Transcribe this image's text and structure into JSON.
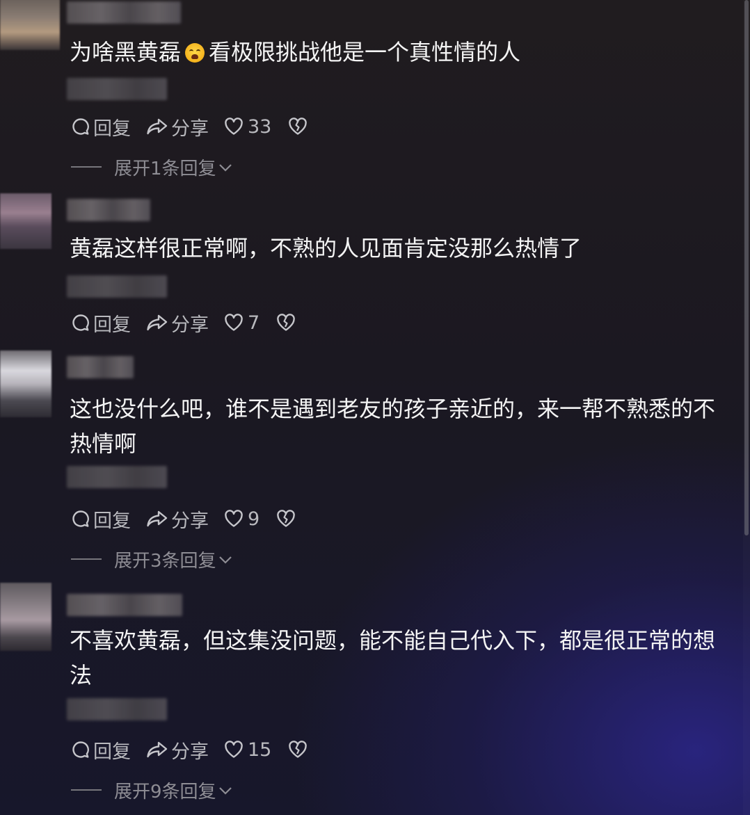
{
  "comments": [
    {
      "text_before": "为啥黑黄磊",
      "emoji": "crying-laughing-emoji",
      "text_after": "看极限挑战他是一个真性情的人",
      "actions": {
        "reply": "回复",
        "share": "分享",
        "likes": "33"
      },
      "expand": "展开1条回复"
    },
    {
      "text": "黄磊这样很正常啊，不熟的人见面肯定没那么热情了",
      "actions": {
        "reply": "回复",
        "share": "分享",
        "likes": "7"
      }
    },
    {
      "text": "这也没什么吧，谁不是遇到老友的孩子亲近的，来一帮不熟悉的不热情啊",
      "actions": {
        "reply": "回复",
        "share": "分享",
        "likes": "9"
      },
      "expand": "展开3条回复"
    },
    {
      "text": "不喜欢黄磊，但这集没问题，能不能自己代入下，都是很正常的想法",
      "actions": {
        "reply": "回复",
        "share": "分享",
        "likes": "15"
      },
      "expand": "展开9条回复"
    }
  ],
  "colors": {
    "background_top": "#201c1f",
    "background_bottom_glow": "#2c268c",
    "text_primary": "#f4f4f4",
    "text_secondary": "#b9b9be",
    "text_muted": "#8e8d94"
  },
  "icons": [
    "reply-bubble-icon",
    "share-arrow-icon",
    "heart-icon",
    "broken-heart-icon",
    "chevron-down-icon"
  ]
}
